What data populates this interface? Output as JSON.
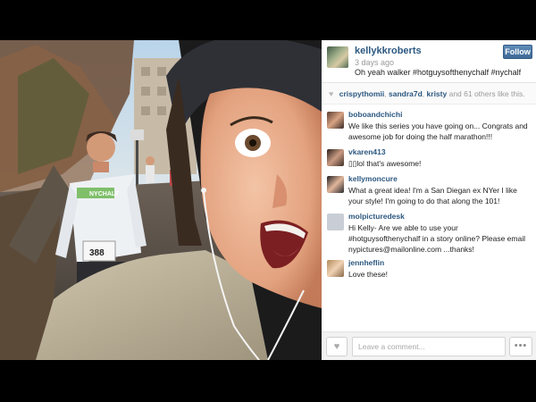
{
  "post": {
    "username": "kellykkroberts",
    "time_ago": "3 days ago",
    "follow_label": "Follow",
    "caption": "Oh yeah walker #hotguysofthenychalf #nychalf"
  },
  "likes": {
    "icon": "heart-icon",
    "likers": [
      "crispythomii",
      "sandra7d",
      "kristy"
    ],
    "others_text": "and 61 others like this."
  },
  "comments": [
    {
      "user": "boboandchichi",
      "text": "We like this series you have going on... Congrats and awesome job for doing the half marathon!!!"
    },
    {
      "user": "vkaren413",
      "text": "▯▯lol that's awesome!"
    },
    {
      "user": "kellymoncure",
      "text": "What a great idea! I'm a San Diegan ex NYer I like your style! I'm going to do that along the 101!"
    },
    {
      "user": "molpicturedesk",
      "text": "Hi Kelly- Are we able to use your #hotguysofthenychalf in a story online? Please email nypictures@mailonline.com ...thanks!"
    },
    {
      "user": "jennheflin",
      "text": "Love these!"
    }
  ],
  "footer": {
    "like_icon": "heart-icon",
    "comment_placeholder": "Leave a comment...",
    "more_label": "•••"
  },
  "photo": {
    "bib_number": "388",
    "shirt_text": "NYCHALF"
  }
}
